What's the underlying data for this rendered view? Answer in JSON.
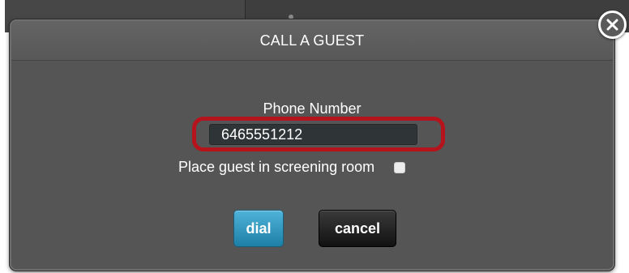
{
  "dialog": {
    "title": "CALL A GUEST",
    "phone_label": "Phone Number",
    "phone_value": "6465551212",
    "screening_label": "Place guest in screening room",
    "screening_checked": false,
    "dial_label": "dial",
    "cancel_label": "cancel"
  },
  "icons": {
    "close": "close-icon"
  },
  "colors": {
    "highlight": "#b5141c",
    "dial_button": "#2a93bd",
    "dialog_bg": "#555555"
  }
}
